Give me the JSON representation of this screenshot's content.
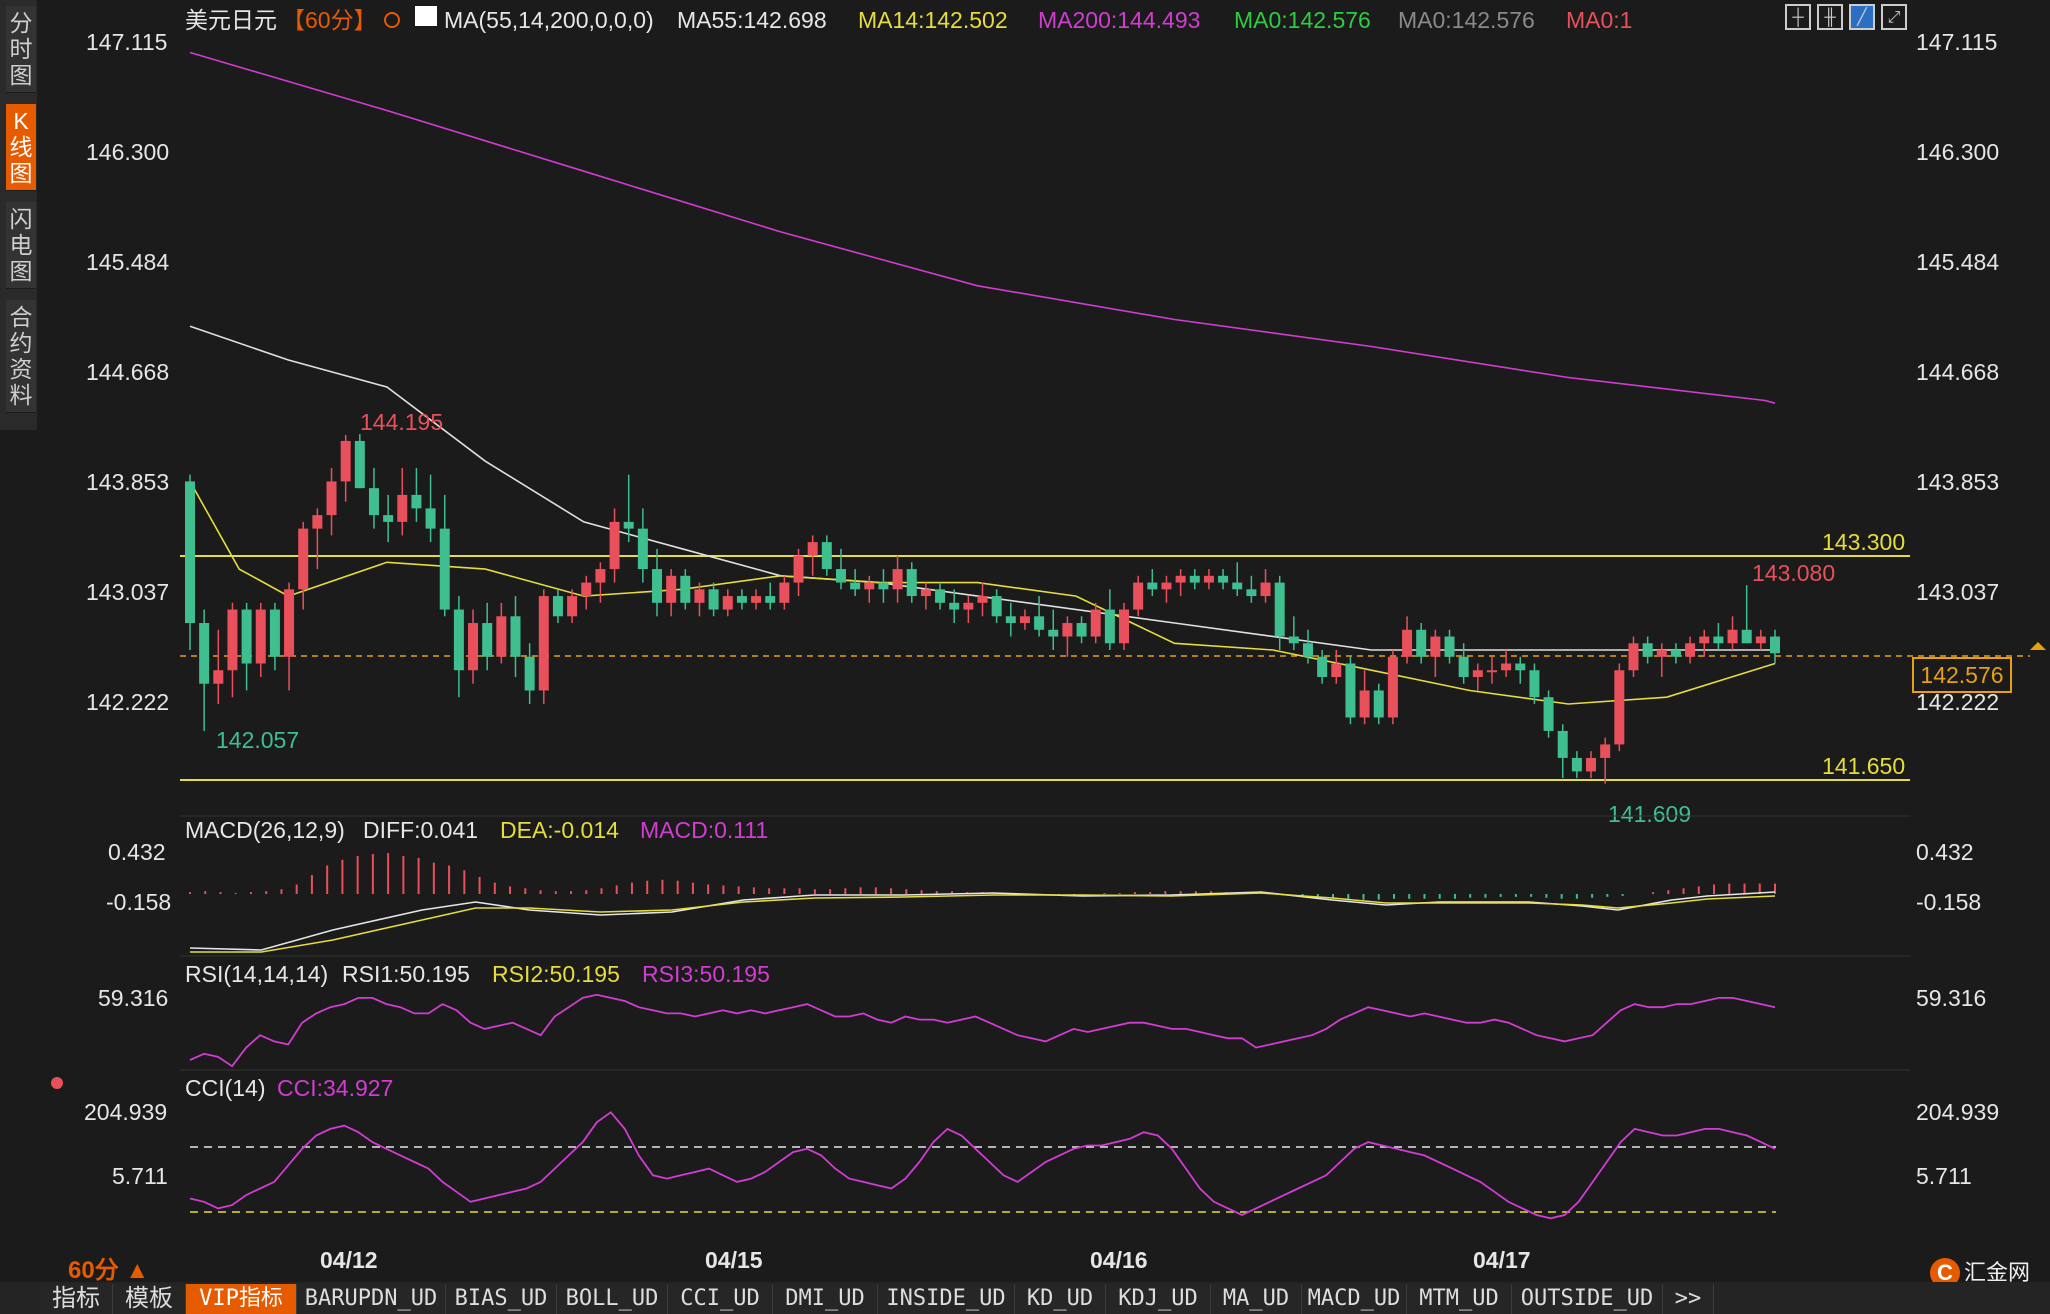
{
  "sidebar": {
    "tabs": [
      {
        "label": "分时图",
        "active": false
      },
      {
        "label": "K线图",
        "active": true
      },
      {
        "label": "闪电图",
        "active": false
      },
      {
        "label": "合约资料",
        "active": false
      }
    ]
  },
  "header": {
    "symbol": "美元日元",
    "period": "【60分】",
    "indicator_params": "MA(55,14,200,0,0,0)",
    "ma55": "MA55:142.698",
    "ma14": "MA14:142.502",
    "ma200": "MA200:144.493",
    "ma0a": "MA0:142.576",
    "ma0b": "MA0:142.576",
    "ma0c": "MA0:1"
  },
  "price_axis": [
    "147.115",
    "146.300",
    "145.484",
    "144.668",
    "143.853",
    "143.037",
    "142.222"
  ],
  "annotations": {
    "high_label": "144.195",
    "low_label": "142.057",
    "high2_label": "143.080",
    "low2_label": "141.609",
    "resistance_label": "143.300",
    "support_label": "141.650",
    "current_price": "142.576"
  },
  "macd": {
    "title": "MACD(26,12,9)",
    "diff": "DIFF:0.041",
    "dea": "DEA:-0.014",
    "macd": "MACD:0.111",
    "axis": [
      "0.432",
      "-0.158"
    ]
  },
  "rsi": {
    "title": "RSI(14,14,14)",
    "rsi1": "RSI1:50.195",
    "rsi2": "RSI2:50.195",
    "rsi3": "RSI3:50.195",
    "axis": [
      "59.316"
    ]
  },
  "cci": {
    "title": "CCI(14)",
    "value": "CCI:34.927",
    "axis": [
      "204.939",
      "5.711"
    ]
  },
  "dates": [
    "04/12",
    "04/15",
    "04/16",
    "04/17"
  ],
  "period_selector": "60分 ▲",
  "bottom_tabs": [
    "指标",
    "模板",
    "VIP指标",
    "BARUPDN_UD",
    "BIAS_UD",
    "BOLL_UD",
    "CCI_UD",
    "DMI_UD",
    "INSIDE_UD",
    "KD_UD",
    "KDJ_UD",
    "MA_UD",
    "MACD_UD",
    "MTM_UD",
    "OUTSIDE_UD",
    ">>"
  ],
  "logo": "汇金网",
  "colors": {
    "up": "#e8505b",
    "down": "#3fbf8f",
    "ma55": "#e0e0e0",
    "ma14": "#e6dc3c",
    "ma200": "#d23cd2",
    "level_line": "#e6dc3c",
    "accent": "#e65a00"
  },
  "chart_data": {
    "type": "candlestick",
    "title": "美元日元【60分】",
    "ylim": [
      141.5,
      147.3
    ],
    "levels": [
      143.3,
      141.65
    ],
    "ohlc": [
      {
        "o": 143.85,
        "h": 143.9,
        "l": 142.6,
        "c": 142.8
      },
      {
        "o": 142.8,
        "h": 142.9,
        "l": 142.0,
        "c": 142.35
      },
      {
        "o": 142.35,
        "h": 142.75,
        "l": 142.2,
        "c": 142.45
      },
      {
        "o": 142.45,
        "h": 142.95,
        "l": 142.25,
        "c": 142.9
      },
      {
        "o": 142.9,
        "h": 142.95,
        "l": 142.3,
        "c": 142.5
      },
      {
        "o": 142.5,
        "h": 142.95,
        "l": 142.4,
        "c": 142.9
      },
      {
        "o": 142.9,
        "h": 142.95,
        "l": 142.45,
        "c": 142.55
      },
      {
        "o": 142.55,
        "h": 143.1,
        "l": 142.3,
        "c": 143.05
      },
      {
        "o": 143.05,
        "h": 143.55,
        "l": 142.9,
        "c": 143.5
      },
      {
        "o": 143.5,
        "h": 143.65,
        "l": 143.2,
        "c": 143.6
      },
      {
        "o": 143.6,
        "h": 143.95,
        "l": 143.45,
        "c": 143.85
      },
      {
        "o": 143.85,
        "h": 144.195,
        "l": 143.7,
        "c": 144.15
      },
      {
        "o": 144.15,
        "h": 144.2,
        "l": 143.8,
        "c": 143.8
      },
      {
        "o": 143.8,
        "h": 143.95,
        "l": 143.5,
        "c": 143.6
      },
      {
        "o": 143.6,
        "h": 143.75,
        "l": 143.4,
        "c": 143.55
      },
      {
        "o": 143.55,
        "h": 143.95,
        "l": 143.45,
        "c": 143.75
      },
      {
        "o": 143.75,
        "h": 143.95,
        "l": 143.55,
        "c": 143.65
      },
      {
        "o": 143.65,
        "h": 143.9,
        "l": 143.4,
        "c": 143.5
      },
      {
        "o": 143.5,
        "h": 143.75,
        "l": 142.85,
        "c": 142.9
      },
      {
        "o": 142.9,
        "h": 143.0,
        "l": 142.25,
        "c": 142.45
      },
      {
        "o": 142.45,
        "h": 142.9,
        "l": 142.35,
        "c": 142.8
      },
      {
        "o": 142.8,
        "h": 142.95,
        "l": 142.45,
        "c": 142.55
      },
      {
        "o": 142.55,
        "h": 142.95,
        "l": 142.5,
        "c": 142.85
      },
      {
        "o": 142.85,
        "h": 143.0,
        "l": 142.4,
        "c": 142.55
      },
      {
        "o": 142.55,
        "h": 142.65,
        "l": 142.2,
        "c": 142.3
      },
      {
        "o": 142.3,
        "h": 143.05,
        "l": 142.2,
        "c": 143.0
      },
      {
        "o": 143.0,
        "h": 143.05,
        "l": 142.8,
        "c": 142.85
      },
      {
        "o": 142.85,
        "h": 143.05,
        "l": 142.8,
        "c": 143.0
      },
      {
        "o": 143.0,
        "h": 143.15,
        "l": 142.9,
        "c": 143.1
      },
      {
        "o": 143.1,
        "h": 143.25,
        "l": 142.95,
        "c": 143.2
      },
      {
        "o": 143.2,
        "h": 143.65,
        "l": 143.1,
        "c": 143.55
      },
      {
        "o": 143.55,
        "h": 143.9,
        "l": 143.4,
        "c": 143.5
      },
      {
        "o": 143.5,
        "h": 143.65,
        "l": 143.1,
        "c": 143.2
      },
      {
        "o": 143.2,
        "h": 143.35,
        "l": 142.85,
        "c": 142.95
      },
      {
        "o": 142.95,
        "h": 143.2,
        "l": 142.85,
        "c": 143.15
      },
      {
        "o": 143.15,
        "h": 143.2,
        "l": 142.9,
        "c": 142.95
      },
      {
        "o": 142.95,
        "h": 143.1,
        "l": 142.85,
        "c": 143.05
      },
      {
        "o": 143.05,
        "h": 143.1,
        "l": 142.85,
        "c": 142.9
      },
      {
        "o": 142.9,
        "h": 143.05,
        "l": 142.85,
        "c": 143.0
      },
      {
        "o": 143.0,
        "h": 143.05,
        "l": 142.9,
        "c": 142.95
      },
      {
        "o": 142.95,
        "h": 143.05,
        "l": 142.9,
        "c": 143.0
      },
      {
        "o": 143.0,
        "h": 143.1,
        "l": 142.9,
        "c": 142.95
      },
      {
        "o": 142.95,
        "h": 143.15,
        "l": 142.9,
        "c": 143.1
      },
      {
        "o": 143.1,
        "h": 143.35,
        "l": 143.0,
        "c": 143.3
      },
      {
        "o": 143.3,
        "h": 143.45,
        "l": 143.15,
        "c": 143.4
      },
      {
        "o": 143.4,
        "h": 143.45,
        "l": 143.15,
        "c": 143.2
      },
      {
        "o": 143.2,
        "h": 143.35,
        "l": 143.05,
        "c": 143.1
      },
      {
        "o": 143.1,
        "h": 143.2,
        "l": 143.0,
        "c": 143.05
      },
      {
        "o": 143.05,
        "h": 143.15,
        "l": 142.95,
        "c": 143.1
      },
      {
        "o": 143.1,
        "h": 143.2,
        "l": 142.95,
        "c": 143.05
      },
      {
        "o": 143.05,
        "h": 143.3,
        "l": 142.95,
        "c": 143.2
      },
      {
        "o": 143.2,
        "h": 143.25,
        "l": 142.95,
        "c": 143.0
      },
      {
        "o": 143.0,
        "h": 143.1,
        "l": 142.9,
        "c": 143.05
      },
      {
        "o": 143.05,
        "h": 143.1,
        "l": 142.9,
        "c": 142.95
      },
      {
        "o": 142.95,
        "h": 143.05,
        "l": 142.8,
        "c": 142.9
      },
      {
        "o": 142.9,
        "h": 143.0,
        "l": 142.8,
        "c": 142.95
      },
      {
        "o": 142.95,
        "h": 143.1,
        "l": 142.85,
        "c": 143.0
      },
      {
        "o": 143.0,
        "h": 143.05,
        "l": 142.8,
        "c": 142.85
      },
      {
        "o": 142.85,
        "h": 142.95,
        "l": 142.7,
        "c": 142.8
      },
      {
        "o": 142.8,
        "h": 142.9,
        "l": 142.75,
        "c": 142.85
      },
      {
        "o": 142.85,
        "h": 143.0,
        "l": 142.7,
        "c": 142.75
      },
      {
        "o": 142.75,
        "h": 142.9,
        "l": 142.6,
        "c": 142.7
      },
      {
        "o": 142.7,
        "h": 142.85,
        "l": 142.55,
        "c": 142.8
      },
      {
        "o": 142.8,
        "h": 142.85,
        "l": 142.65,
        "c": 142.7
      },
      {
        "o": 142.7,
        "h": 142.95,
        "l": 142.65,
        "c": 142.9
      },
      {
        "o": 142.9,
        "h": 143.05,
        "l": 142.6,
        "c": 142.65
      },
      {
        "o": 142.65,
        "h": 142.95,
        "l": 142.6,
        "c": 142.9
      },
      {
        "o": 142.9,
        "h": 143.15,
        "l": 142.85,
        "c": 143.1
      },
      {
        "o": 143.1,
        "h": 143.2,
        "l": 143.0,
        "c": 143.05
      },
      {
        "o": 143.05,
        "h": 143.15,
        "l": 142.95,
        "c": 143.1
      },
      {
        "o": 143.1,
        "h": 143.2,
        "l": 143.0,
        "c": 143.15
      },
      {
        "o": 143.15,
        "h": 143.2,
        "l": 143.05,
        "c": 143.1
      },
      {
        "o": 143.1,
        "h": 143.2,
        "l": 143.05,
        "c": 143.15
      },
      {
        "o": 143.15,
        "h": 143.2,
        "l": 143.05,
        "c": 143.1
      },
      {
        "o": 143.1,
        "h": 143.25,
        "l": 143.0,
        "c": 143.05
      },
      {
        "o": 143.05,
        "h": 143.15,
        "l": 142.95,
        "c": 143.0
      },
      {
        "o": 143.0,
        "h": 143.2,
        "l": 142.95,
        "c": 143.1
      },
      {
        "o": 143.1,
        "h": 143.15,
        "l": 142.6,
        "c": 142.7
      },
      {
        "o": 142.7,
        "h": 142.85,
        "l": 142.6,
        "c": 142.65
      },
      {
        "o": 142.65,
        "h": 142.75,
        "l": 142.5,
        "c": 142.55
      },
      {
        "o": 142.55,
        "h": 142.6,
        "l": 142.35,
        "c": 142.4
      },
      {
        "o": 142.4,
        "h": 142.6,
        "l": 142.35,
        "c": 142.5
      },
      {
        "o": 142.5,
        "h": 142.55,
        "l": 142.05,
        "c": 142.1
      },
      {
        "o": 142.1,
        "h": 142.45,
        "l": 142.05,
        "c": 142.3
      },
      {
        "o": 142.3,
        "h": 142.35,
        "l": 142.05,
        "c": 142.1
      },
      {
        "o": 142.1,
        "h": 142.6,
        "l": 142.05,
        "c": 142.55
      },
      {
        "o": 142.55,
        "h": 142.85,
        "l": 142.5,
        "c": 142.75
      },
      {
        "o": 142.75,
        "h": 142.8,
        "l": 142.5,
        "c": 142.55
      },
      {
        "o": 142.55,
        "h": 142.75,
        "l": 142.4,
        "c": 142.7
      },
      {
        "o": 142.7,
        "h": 142.75,
        "l": 142.5,
        "c": 142.55
      },
      {
        "o": 142.55,
        "h": 142.65,
        "l": 142.35,
        "c": 142.4
      },
      {
        "o": 142.4,
        "h": 142.5,
        "l": 142.3,
        "c": 142.45
      },
      {
        "o": 142.45,
        "h": 142.55,
        "l": 142.35,
        "c": 142.45
      },
      {
        "o": 142.45,
        "h": 142.6,
        "l": 142.4,
        "c": 142.5
      },
      {
        "o": 142.5,
        "h": 142.55,
        "l": 142.35,
        "c": 142.45
      },
      {
        "o": 142.45,
        "h": 142.5,
        "l": 142.2,
        "c": 142.25
      },
      {
        "o": 142.25,
        "h": 142.3,
        "l": 141.95,
        "c": 142.0
      },
      {
        "o": 142.0,
        "h": 142.05,
        "l": 141.65,
        "c": 141.8
      },
      {
        "o": 141.8,
        "h": 141.85,
        "l": 141.65,
        "c": 141.7
      },
      {
        "o": 141.7,
        "h": 141.85,
        "l": 141.65,
        "c": 141.8
      },
      {
        "o": 141.8,
        "h": 141.95,
        "l": 141.609,
        "c": 141.9
      },
      {
        "o": 141.9,
        "h": 142.5,
        "l": 141.85,
        "c": 142.45
      },
      {
        "o": 142.45,
        "h": 142.7,
        "l": 142.4,
        "c": 142.65
      },
      {
        "o": 142.65,
        "h": 142.7,
        "l": 142.5,
        "c": 142.55
      },
      {
        "o": 142.55,
        "h": 142.65,
        "l": 142.4,
        "c": 142.6
      },
      {
        "o": 142.6,
        "h": 142.65,
        "l": 142.5,
        "c": 142.55
      },
      {
        "o": 142.55,
        "h": 142.7,
        "l": 142.5,
        "c": 142.65
      },
      {
        "o": 142.65,
        "h": 142.75,
        "l": 142.55,
        "c": 142.7
      },
      {
        "o": 142.7,
        "h": 142.8,
        "l": 142.6,
        "c": 142.65
      },
      {
        "o": 142.65,
        "h": 142.85,
        "l": 142.6,
        "c": 142.75
      },
      {
        "o": 142.75,
        "h": 143.08,
        "l": 142.65,
        "c": 142.65
      },
      {
        "o": 142.65,
        "h": 142.75,
        "l": 142.6,
        "c": 142.7
      },
      {
        "o": 142.7,
        "h": 142.75,
        "l": 142.5,
        "c": 142.576
      }
    ],
    "ma200_points": [
      [
        0,
        147.03
      ],
      [
        20,
        146.6
      ],
      [
        40,
        146.15
      ],
      [
        60,
        145.7
      ],
      [
        80,
        145.3
      ],
      [
        100,
        145.05
      ],
      [
        120,
        144.85
      ],
      [
        140,
        144.62
      ],
      [
        160,
        144.45
      ],
      [
        161,
        144.43
      ]
    ],
    "ma55_points": [
      [
        0,
        145.0
      ],
      [
        10,
        144.75
      ],
      [
        20,
        144.55
      ],
      [
        30,
        144.0
      ],
      [
        40,
        143.55
      ],
      [
        50,
        143.35
      ],
      [
        60,
        143.15
      ],
      [
        70,
        143.1
      ],
      [
        80,
        143.0
      ],
      [
        100,
        142.8
      ],
      [
        120,
        142.6
      ],
      [
        140,
        142.6
      ],
      [
        161,
        142.6
      ]
    ],
    "ma14_points": [
      [
        0,
        143.85
      ],
      [
        5,
        143.2
      ],
      [
        10,
        143.0
      ],
      [
        20,
        143.25
      ],
      [
        30,
        143.2
      ],
      [
        40,
        143.0
      ],
      [
        50,
        143.05
      ],
      [
        60,
        143.15
      ],
      [
        70,
        143.1
      ],
      [
        80,
        143.1
      ],
      [
        90,
        143.0
      ],
      [
        100,
        142.65
      ],
      [
        110,
        142.6
      ],
      [
        120,
        142.45
      ],
      [
        130,
        142.3
      ],
      [
        140,
        142.2
      ],
      [
        150,
        142.25
      ],
      [
        161,
        142.5
      ]
    ],
    "macd_hist": [
      0.02,
      0.03,
      0.02,
      0.01,
      0.02,
      0.03,
      0.05,
      0.1,
      0.2,
      0.3,
      0.36,
      0.4,
      0.42,
      0.43,
      0.4,
      0.38,
      0.33,
      0.3,
      0.25,
      0.18,
      0.12,
      0.08,
      0.06,
      0.04,
      0.03,
      0.03,
      0.04,
      0.06,
      0.09,
      0.12,
      0.14,
      0.15,
      0.14,
      0.12,
      0.1,
      0.09,
      0.08,
      0.07,
      0.06,
      0.06,
      0.06,
      0.05,
      0.05,
      0.06,
      0.07,
      0.07,
      0.06,
      0.05,
      0.04,
      0.03,
      0.03,
      0.02,
      0.02,
      0.01,
      0.0,
      -0.01,
      -0.01,
      -0.02,
      -0.01,
      0.0,
      0.01,
      0.01,
      0.02,
      0.02,
      0.03,
      0.03,
      0.03,
      0.03,
      0.02,
      0.02,
      0.01,
      0.0,
      -0.01,
      -0.02,
      -0.03,
      -0.04,
      -0.05,
      -0.06,
      -0.06,
      -0.05,
      -0.05,
      -0.05,
      -0.05,
      -0.05,
      -0.04,
      -0.04,
      -0.03,
      -0.03,
      -0.03,
      -0.04,
      -0.05,
      -0.05,
      -0.04,
      -0.03,
      -0.02,
      0.0,
      0.02,
      0.04,
      0.06,
      0.08,
      0.1,
      0.11,
      0.11,
      0.11,
      0.11
    ],
    "rsi_values": [
      40,
      42,
      41,
      38,
      44,
      48,
      46,
      45,
      52,
      55,
      57,
      58,
      60,
      60,
      58,
      57,
      55,
      55,
      58,
      56,
      52,
      50,
      51,
      52,
      50,
      48,
      54,
      57,
      60,
      61,
      60,
      59,
      57,
      56,
      55,
      55,
      54,
      55,
      56,
      55,
      56,
      55,
      56,
      57,
      58,
      56,
      54,
      54,
      55,
      53,
      52,
      54,
      53,
      53,
      52,
      53,
      54,
      52,
      50,
      48,
      47,
      46,
      48,
      50,
      49,
      50,
      51,
      52,
      52,
      51,
      50,
      50,
      49,
      48,
      47,
      47,
      44,
      45,
      46,
      47,
      48,
      50,
      53,
      55,
      57,
      56,
      55,
      54,
      55,
      54,
      53,
      52,
      52,
      53,
      52,
      50,
      48,
      47,
      46,
      47,
      48,
      52,
      56,
      58,
      57,
      57,
      58,
      58,
      59,
      60,
      60,
      59,
      58,
      57
    ],
    "cci_values": [
      -50,
      -60,
      -80,
      -70,
      -40,
      -20,
      0,
      50,
      100,
      140,
      160,
      170,
      150,
      120,
      100,
      80,
      60,
      40,
      0,
      -30,
      -60,
      -50,
      -40,
      -30,
      -20,
      0,
      40,
      80,
      120,
      180,
      210,
      160,
      80,
      20,
      10,
      20,
      30,
      40,
      20,
      0,
      10,
      30,
      60,
      90,
      100,
      80,
      40,
      10,
      0,
      -10,
      -20,
      10,
      60,
      120,
      160,
      140,
      100,
      60,
      20,
      0,
      30,
      60,
      80,
      100,
      110,
      110,
      120,
      130,
      150,
      140,
      100,
      40,
      -20,
      -60,
      -80,
      -100,
      -80,
      -60,
      -40,
      -20,
      0,
      20,
      60,
      100,
      120,
      110,
      100,
      90,
      80,
      60,
      40,
      20,
      0,
      -30,
      -60,
      -80,
      -100,
      -110,
      -100,
      -60,
      0,
      60,
      120,
      160,
      150,
      140,
      140,
      150,
      160,
      160,
      150,
      140,
      120,
      100
    ]
  }
}
